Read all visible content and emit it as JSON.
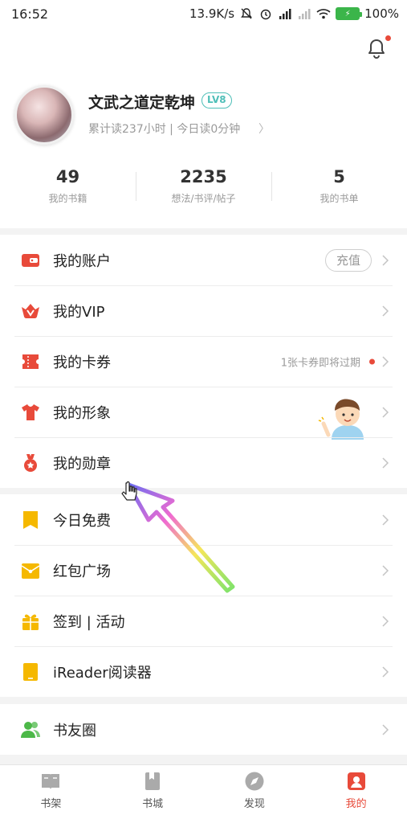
{
  "status_bar": {
    "time": "16:52",
    "network_speed": "13.9K/s",
    "battery": "100%"
  },
  "profile": {
    "username": "文武之道定乾坤",
    "level": "LV8",
    "read_stats": "累计读237小时 | 今日读0分钟",
    "counts": [
      {
        "value": "49",
        "label": "我的书籍"
      },
      {
        "value": "2235",
        "label": "想法/书评/帖子"
      },
      {
        "value": "5",
        "label": "我的书单"
      }
    ]
  },
  "menu_group_1": [
    {
      "label": "我的账户",
      "icon": "wallet-icon",
      "action": "充值"
    },
    {
      "label": "我的VIP",
      "icon": "vip-crown-icon"
    },
    {
      "label": "我的卡券",
      "icon": "ticket-icon",
      "note": "1张卡券即将过期"
    },
    {
      "label": "我的形象",
      "icon": "shirt-icon"
    },
    {
      "label": "我的勋章",
      "icon": "medal-icon"
    }
  ],
  "menu_group_2": [
    {
      "label": "今日免费",
      "icon": "bookmark-icon"
    },
    {
      "label": "红包广场",
      "icon": "red-envelope-icon"
    },
    {
      "label": "签到 | 活动",
      "icon": "gift-icon"
    },
    {
      "label": "iReader阅读器",
      "icon": "ereader-icon"
    }
  ],
  "menu_group_3": [
    {
      "label": "书友圈",
      "icon": "friends-icon"
    }
  ],
  "tabbar": [
    {
      "label": "书架",
      "icon": "bookshelf-icon"
    },
    {
      "label": "书城",
      "icon": "bookstore-icon"
    },
    {
      "label": "发现",
      "icon": "compass-icon"
    },
    {
      "label": "我的",
      "icon": "me-icon",
      "active": true
    }
  ],
  "colors": {
    "accent_red": "#e84a3a",
    "accent_yellow": "#f5b800",
    "accent_green": "#4cb848",
    "level_teal": "#4fbfb8"
  }
}
